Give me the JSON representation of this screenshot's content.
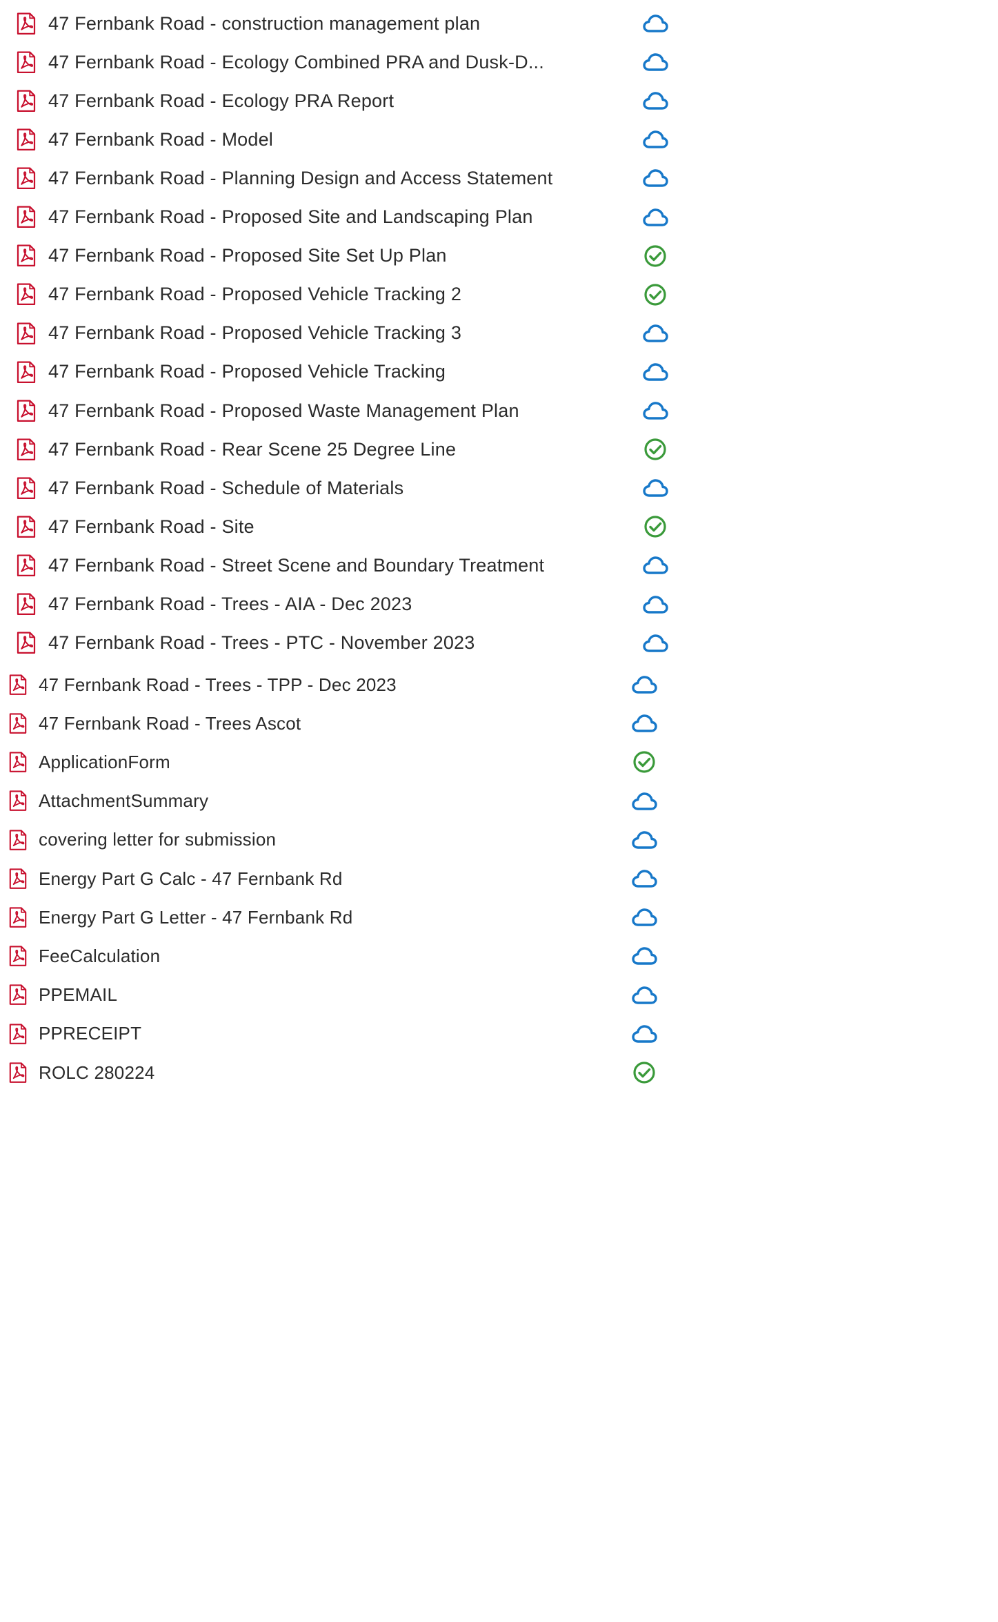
{
  "colors": {
    "pdf_red": "#c8102e",
    "cloud_blue": "#1778c9",
    "synced_green": "#3a9a3a",
    "text": "#2b2b2b"
  },
  "files": [
    {
      "name": "47 Fernbank Road - construction management plan",
      "status": "cloud"
    },
    {
      "name": "47 Fernbank Road - Ecology Combined PRA and Dusk-D...",
      "status": "cloud"
    },
    {
      "name": "47 Fernbank Road - Ecology PRA Report",
      "status": "cloud"
    },
    {
      "name": "47 Fernbank Road - Model",
      "status": "cloud"
    },
    {
      "name": "47 Fernbank Road - Planning Design and Access Statement",
      "status": "cloud"
    },
    {
      "name": "47 Fernbank Road - Proposed Site and Landscaping Plan",
      "status": "cloud"
    },
    {
      "name": "47 Fernbank Road - Proposed Site Set Up Plan",
      "status": "synced"
    },
    {
      "name": "47 Fernbank Road - Proposed Vehicle Tracking 2",
      "status": "synced"
    },
    {
      "name": "47 Fernbank Road - Proposed Vehicle Tracking 3",
      "status": "cloud"
    },
    {
      "name": "47 Fernbank Road - Proposed Vehicle Tracking",
      "status": "cloud"
    },
    {
      "name": "47 Fernbank Road - Proposed Waste Management Plan",
      "status": "cloud"
    },
    {
      "name": "47 Fernbank Road - Rear Scene 25 Degree Line",
      "status": "synced"
    },
    {
      "name": "47 Fernbank Road - Schedule of Materials",
      "status": "cloud"
    },
    {
      "name": "47 Fernbank Road - Site",
      "status": "synced"
    },
    {
      "name": "47 Fernbank Road - Street Scene and Boundary Treatment",
      "status": "cloud"
    },
    {
      "name": "47 Fernbank Road - Trees - AIA - Dec 2023",
      "status": "cloud"
    },
    {
      "name": "47 Fernbank Road - Trees - PTC - November 2023",
      "status": "cloud"
    },
    {
      "name": "47 Fernbank Road - Trees - TPP - Dec 2023",
      "status": "cloud"
    },
    {
      "name": "47 Fernbank Road - Trees Ascot",
      "status": "cloud"
    },
    {
      "name": "ApplicationForm",
      "status": "synced"
    },
    {
      "name": "AttachmentSummary",
      "status": "cloud"
    },
    {
      "name": "covering letter for submission",
      "status": "cloud"
    },
    {
      "name": "Energy Part G Calc - 47 Fernbank Rd",
      "status": "cloud"
    },
    {
      "name": "Energy Part G Letter - 47 Fernbank Rd",
      "status": "cloud"
    },
    {
      "name": "FeeCalculation",
      "status": "cloud"
    },
    {
      "name": "PPEMAIL",
      "status": "cloud"
    },
    {
      "name": "PPRECEIPT",
      "status": "cloud"
    },
    {
      "name": "ROLC 280224",
      "status": "synced"
    }
  ]
}
